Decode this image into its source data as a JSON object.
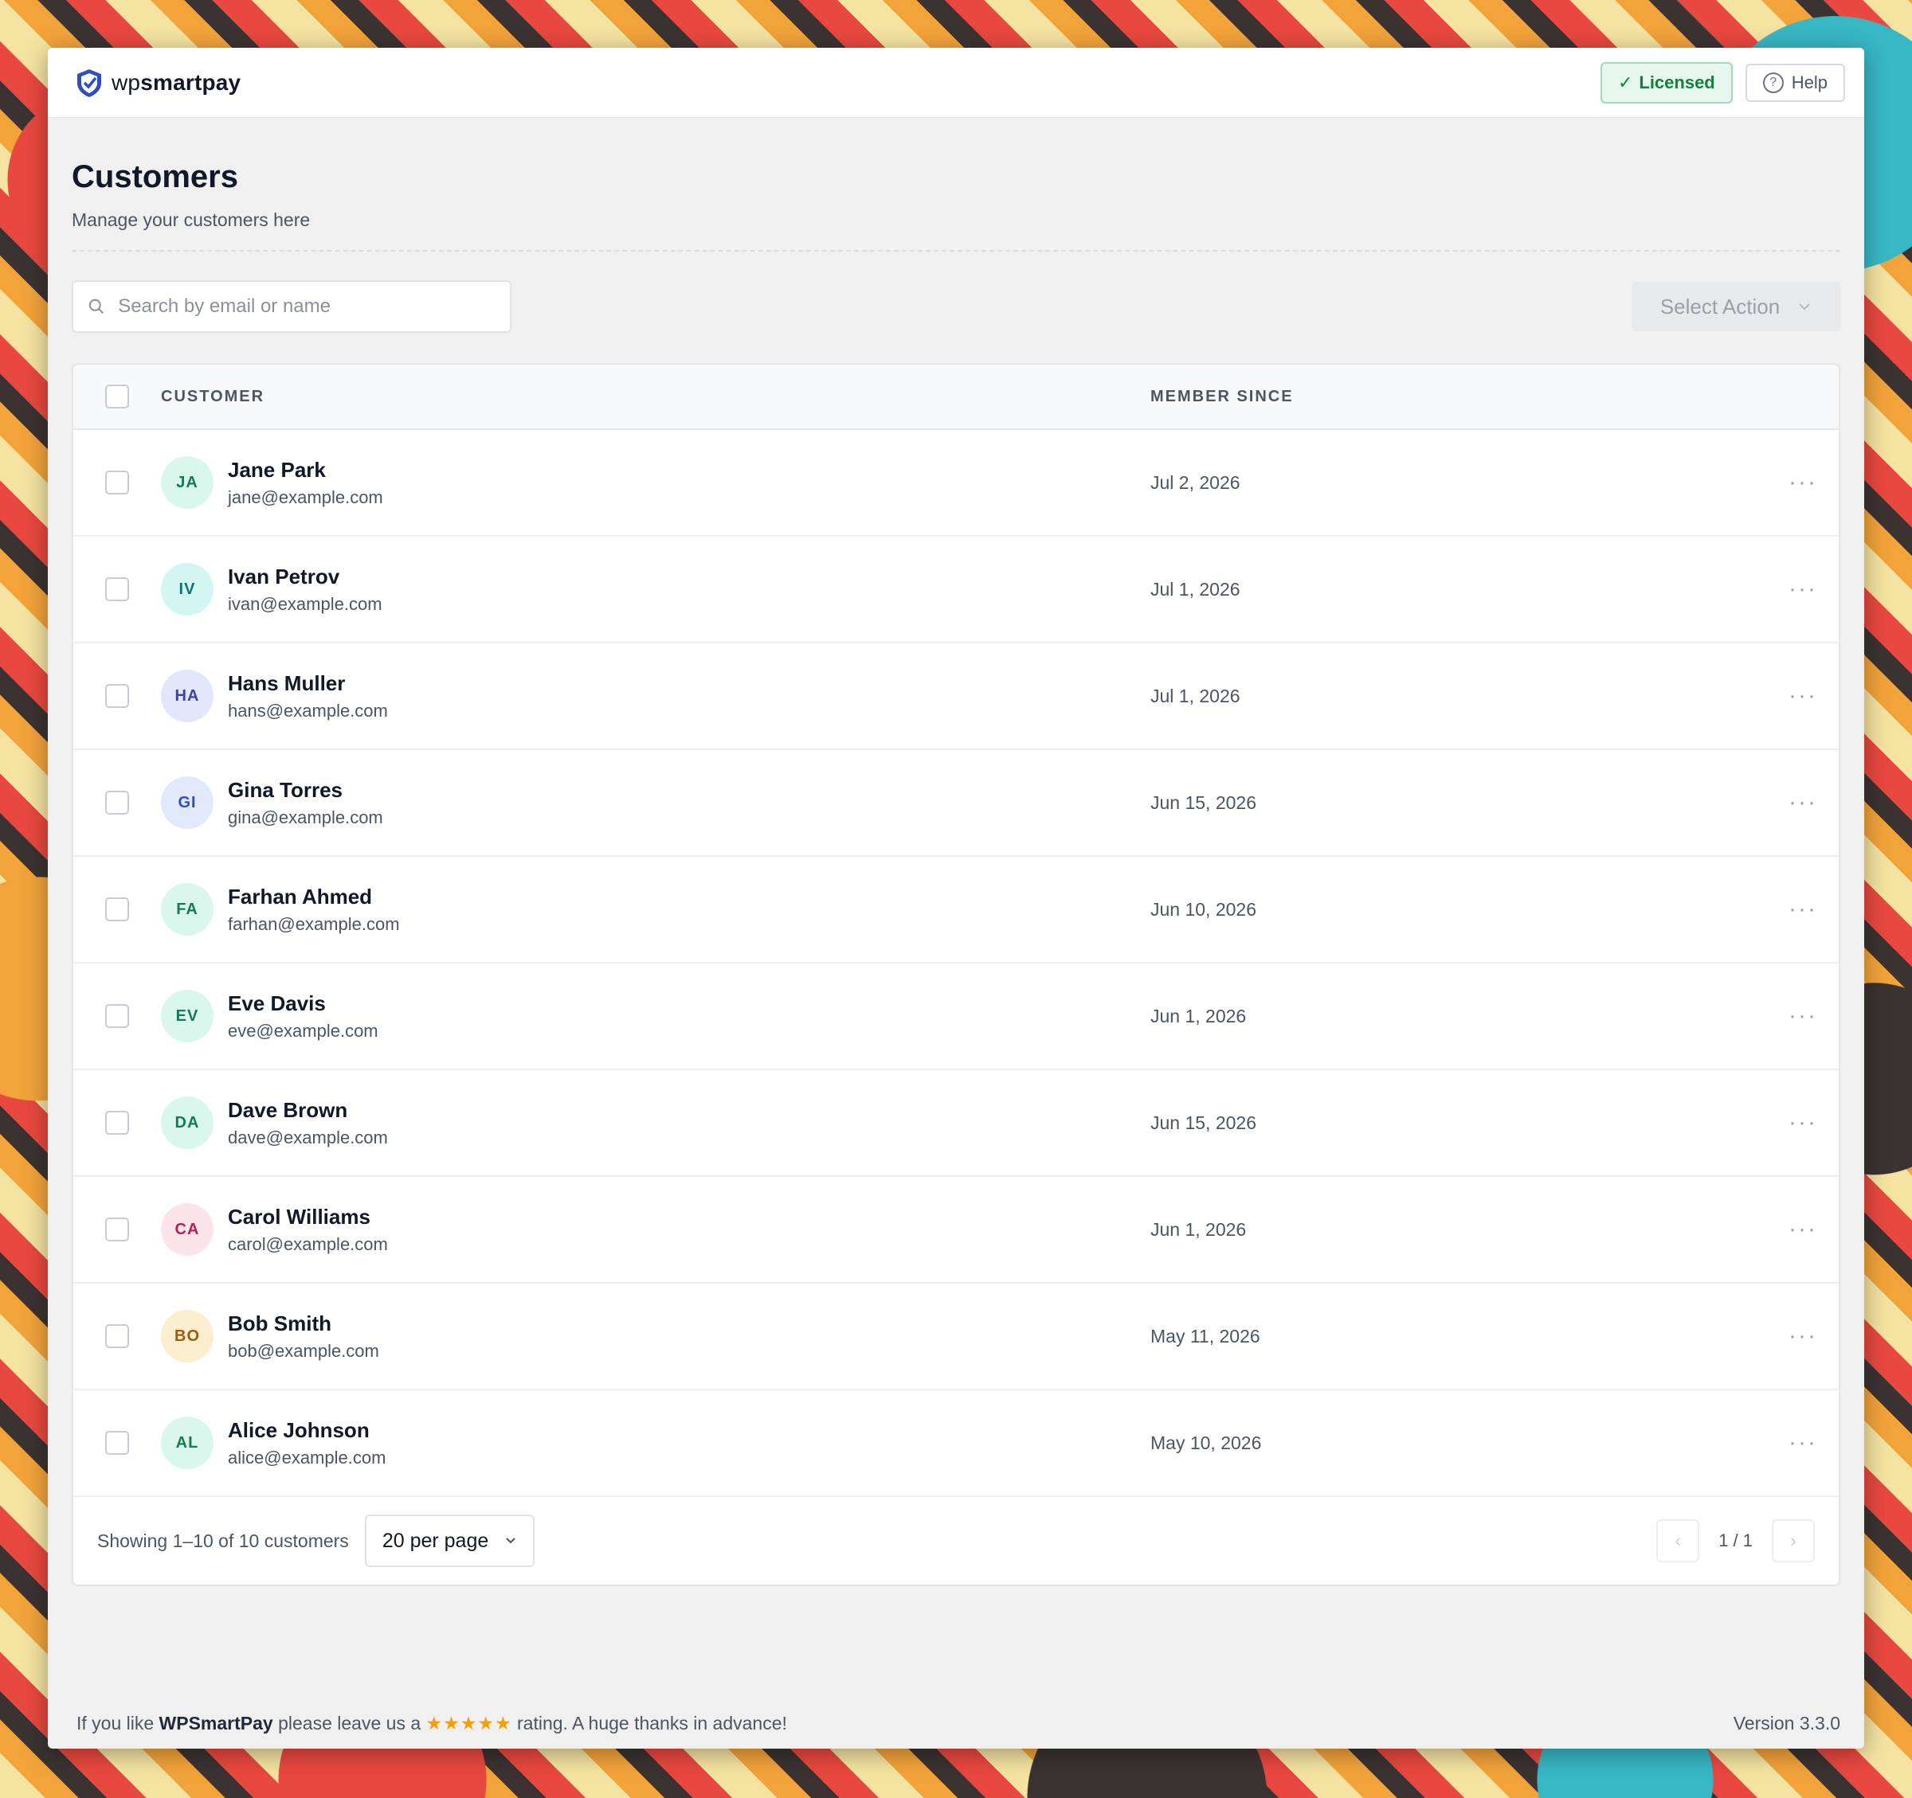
{
  "brand": {
    "prefix": "wp",
    "name": "smartpay"
  },
  "header": {
    "licensed_label": "Licensed",
    "licensed_check": "✓",
    "help_label": "Help",
    "help_glyph": "?"
  },
  "page": {
    "title": "Customers",
    "subtitle": "Manage your customers here"
  },
  "search": {
    "placeholder": "Search by email or name"
  },
  "bulk": {
    "select_action_label": "Select Action"
  },
  "table": {
    "columns": {
      "customer": "CUSTOMER",
      "member_since": "MEMBER SINCE"
    },
    "rows": [
      {
        "initials": "JA",
        "name": "Jane Park",
        "email": "jane@example.com",
        "since": "Jul 2, 2026",
        "avatar_bg": "#d9f7ec",
        "avatar_fg": "#177a52"
      },
      {
        "initials": "IV",
        "name": "Ivan Petrov",
        "email": "ivan@example.com",
        "since": "Jul 1, 2026",
        "avatar_bg": "#d3f6f2",
        "avatar_fg": "#0f766e"
      },
      {
        "initials": "HA",
        "name": "Hans Muller",
        "email": "hans@example.com",
        "since": "Jul 1, 2026",
        "avatar_bg": "#e3e7fb",
        "avatar_fg": "#3b3fb3"
      },
      {
        "initials": "GI",
        "name": "Gina Torres",
        "email": "gina@example.com",
        "since": "Jun 15, 2026",
        "avatar_bg": "#e1e9fb",
        "avatar_fg": "#2f4fbf"
      },
      {
        "initials": "FA",
        "name": "Farhan Ahmed",
        "email": "farhan@example.com",
        "since": "Jun 10, 2026",
        "avatar_bg": "#d9f7ec",
        "avatar_fg": "#177a52"
      },
      {
        "initials": "EV",
        "name": "Eve Davis",
        "email": "eve@example.com",
        "since": "Jun 1, 2026",
        "avatar_bg": "#d9f7ec",
        "avatar_fg": "#177a52"
      },
      {
        "initials": "DA",
        "name": "Dave Brown",
        "email": "dave@example.com",
        "since": "Jun 15, 2026",
        "avatar_bg": "#d9f7ec",
        "avatar_fg": "#177a52"
      },
      {
        "initials": "CA",
        "name": "Carol Williams",
        "email": "carol@example.com",
        "since": "Jun 1, 2026",
        "avatar_bg": "#fbe4ea",
        "avatar_fg": "#b4234d"
      },
      {
        "initials": "BO",
        "name": "Bob Smith",
        "email": "bob@example.com",
        "since": "May 11, 2026",
        "avatar_bg": "#fcefcf",
        "avatar_fg": "#a0590c"
      },
      {
        "initials": "AL",
        "name": "Alice Johnson",
        "email": "alice@example.com",
        "since": "May 10, 2026",
        "avatar_bg": "#d9f7ec",
        "avatar_fg": "#177a52"
      }
    ],
    "row_menu_glyph": "···"
  },
  "pagination": {
    "showing": "Showing 1–10 of 10 customers",
    "per_page": "20 per page",
    "page_indicator": "1 / 1",
    "prev_glyph": "‹",
    "next_glyph": "›"
  },
  "footer": {
    "text_before": "If you like ",
    "brand": "WPSmartPay",
    "text_middle": " please leave us a ",
    "stars": "★★★★★",
    "text_after": " rating. A huge thanks in advance!",
    "version": "Version 3.3.0"
  }
}
